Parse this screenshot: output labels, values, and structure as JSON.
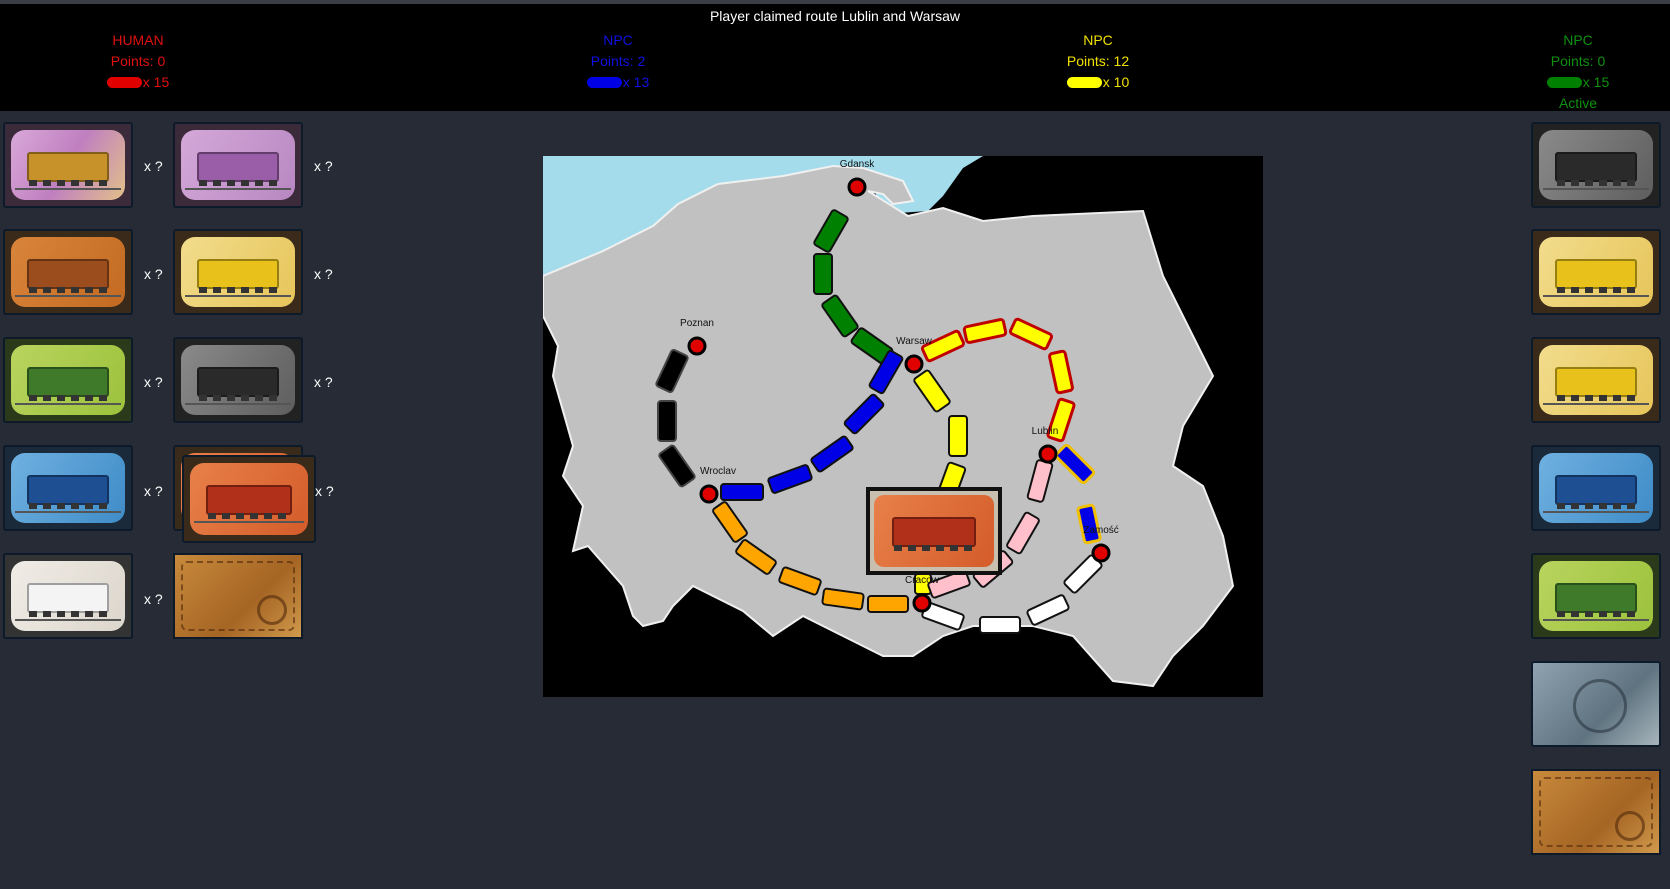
{
  "status": "Player claimed route Lublin and Warsaw",
  "players": [
    {
      "role": "HUMAN",
      "points_label": "Points: 0",
      "trains_label": "x 15",
      "color": "#e00000"
    },
    {
      "role": "NPC",
      "points_label": "Points: 2",
      "trains_label": "x 13",
      "color": "#0000e6"
    },
    {
      "role": "NPC",
      "points_label": "Points: 12",
      "trains_label": "x 10",
      "color": "#ffff00"
    },
    {
      "role": "NPC",
      "points_label": "Points: 0",
      "trains_label": "x 15",
      "color": "#008000",
      "active_label": "Active"
    }
  ],
  "hand": [
    {
      "card": "locomotive",
      "count": "x ?"
    },
    {
      "card": "purple",
      "count": "x ?"
    },
    {
      "card": "orange",
      "count": "x ?"
    },
    {
      "card": "yellow",
      "count": "x ?"
    },
    {
      "card": "green",
      "count": "x ?"
    },
    {
      "card": "black",
      "count": "x ?"
    },
    {
      "card": "blue",
      "count": "x ?"
    },
    {
      "card": "red",
      "count": "x ?"
    },
    {
      "card": "white",
      "count": "x ?"
    },
    {
      "card": "destination-ticket",
      "count": ""
    }
  ],
  "market": [
    "black",
    "yellow",
    "yellow",
    "blue",
    "green",
    "train-deck",
    "destination-deck"
  ],
  "dragged_card": "red",
  "cities": [
    {
      "name": "Gdansk"
    },
    {
      "name": "Poznan"
    },
    {
      "name": "Warsaw"
    },
    {
      "name": "Wroclav"
    },
    {
      "name": "Lublin"
    },
    {
      "name": "Cracow"
    },
    {
      "name": "Zamość"
    }
  ]
}
